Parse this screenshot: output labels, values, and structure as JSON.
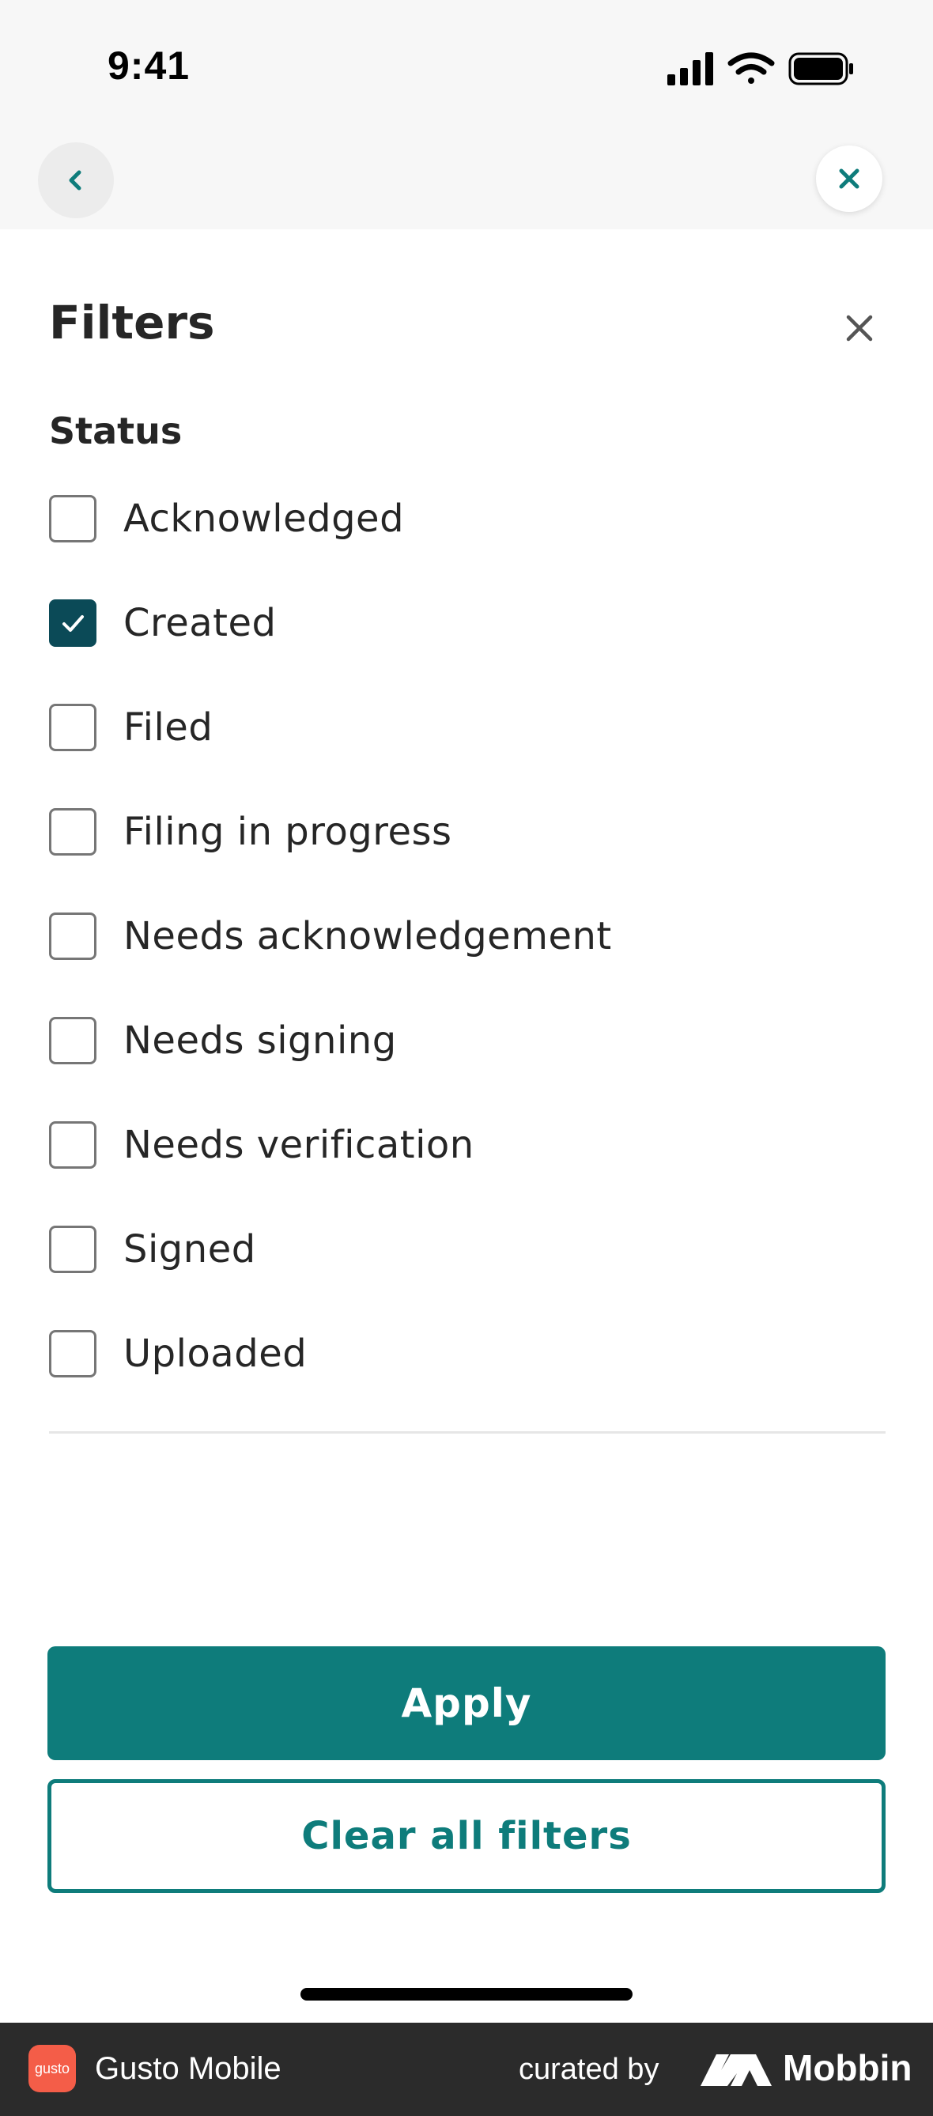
{
  "status_bar": {
    "time": "9:41",
    "icons": [
      "signal-icon",
      "wifi-icon",
      "battery-icon"
    ]
  },
  "top_nav": {
    "back_icon": "chevron-left-icon",
    "close_icon": "close-icon",
    "accent_color": "#0e7c7b"
  },
  "sheet": {
    "title": "Filters",
    "close_icon": "close-icon",
    "section_label": "Status",
    "options": [
      {
        "label": "Acknowledged",
        "checked": false
      },
      {
        "label": "Created",
        "checked": true
      },
      {
        "label": "Filed",
        "checked": false
      },
      {
        "label": "Filing in progress",
        "checked": false
      },
      {
        "label": "Needs acknowledgement",
        "checked": false
      },
      {
        "label": "Needs signing",
        "checked": false
      },
      {
        "label": "Needs verification",
        "checked": false
      },
      {
        "label": "Signed",
        "checked": false
      },
      {
        "label": "Uploaded",
        "checked": false
      }
    ],
    "checkbox_checked_color": "#0b4a57"
  },
  "actions": {
    "apply_label": "Apply",
    "clear_label": "Clear all filters",
    "primary_color": "#0e7c7b"
  },
  "footer": {
    "app_logo_text": "gusto",
    "app_name": "Gusto Mobile",
    "curated_by": "curated by",
    "brand": "Mobbin",
    "logo_color": "#f45d48"
  }
}
